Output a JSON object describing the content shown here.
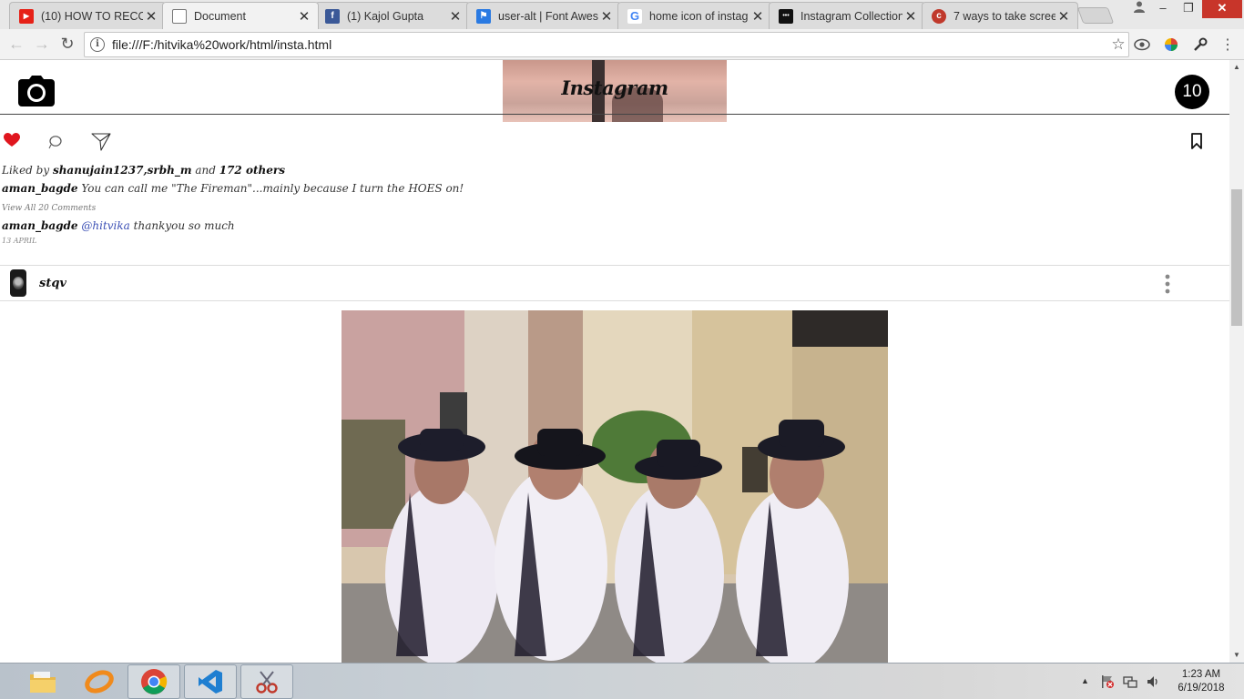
{
  "browser": {
    "tabs": [
      {
        "title": "(10) HOW TO RECOR",
        "favicon": "youtube-icon",
        "color": "#e62117",
        "glyph": "▶"
      },
      {
        "title": "Document",
        "favicon": "document-icon",
        "color": "#ffffff",
        "glyph": ""
      },
      {
        "title": "(1) Kajol Gupta",
        "favicon": "facebook-icon",
        "color": "#3b5998",
        "glyph": "f"
      },
      {
        "title": "user-alt | Font Awes",
        "favicon": "flag-icon",
        "color": "#2a7ae2",
        "glyph": "⚑"
      },
      {
        "title": "home icon of instag",
        "favicon": "google-icon",
        "color": "#ffffff",
        "glyph": "G"
      },
      {
        "title": "Instagram Collection",
        "favicon": "collection-icon",
        "color": "#111111",
        "glyph": "•••"
      },
      {
        "title": "7 ways to take scree",
        "favicon": "site-icon",
        "color": "#c0392b",
        "glyph": "c"
      }
    ],
    "url": "file:///F:/hitvika%20work/html/insta.html"
  },
  "page": {
    "header": {
      "logo_text": "Instagram",
      "badge_count": "10"
    },
    "post1": {
      "liked_prefix": "Liked by ",
      "liked_users": "shanujain1237,srbh_m",
      "liked_and": " and ",
      "liked_others": "172 others",
      "caption_user": "aman_bagde",
      "caption_text": " You can call me \"The Fireman\"...mainly because I turn the HOES on!",
      "view_comments": "View All 20 Comments",
      "comment_user": "aman_bagde",
      "comment_mention": "@hitvika",
      "comment_text": " thankyou so much",
      "date": "13 APRIL"
    },
    "post2": {
      "username": "stqv"
    }
  },
  "taskbar": {
    "time": "1:23 AM",
    "date": "6/19/2018"
  },
  "colors": {
    "like_red": "#e0161e",
    "mention_blue": "#3b4fb5"
  }
}
